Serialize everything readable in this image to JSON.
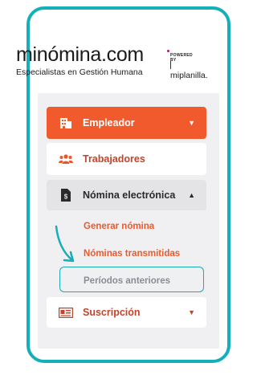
{
  "brand": {
    "logo_text": "minómina.com",
    "tagline": "Especialistas en Gestión Humana",
    "powered_by": "POWERED BY",
    "partner": "miplanilla."
  },
  "menu": {
    "items": [
      {
        "label": "Empleador",
        "icon": "building-icon",
        "caret": "▼",
        "state": "active"
      },
      {
        "label": "Trabajadores",
        "icon": "users-icon",
        "state": "normal"
      },
      {
        "label": "Nómina electrónica",
        "icon": "invoice-icon",
        "caret": "▲",
        "state": "expanded"
      },
      {
        "label": "Suscripción",
        "icon": "id-card-icon",
        "caret": "▼",
        "state": "normal"
      }
    ],
    "submenu": [
      {
        "label": "Generar nómina"
      },
      {
        "label": "Nóminas transmitidas"
      },
      {
        "label": "Períodos anteriores",
        "highlighted": true
      }
    ]
  },
  "colors": {
    "accent": "#f15a2d",
    "frame": "#15aebb",
    "highlight_border": "#1aa9b7"
  }
}
